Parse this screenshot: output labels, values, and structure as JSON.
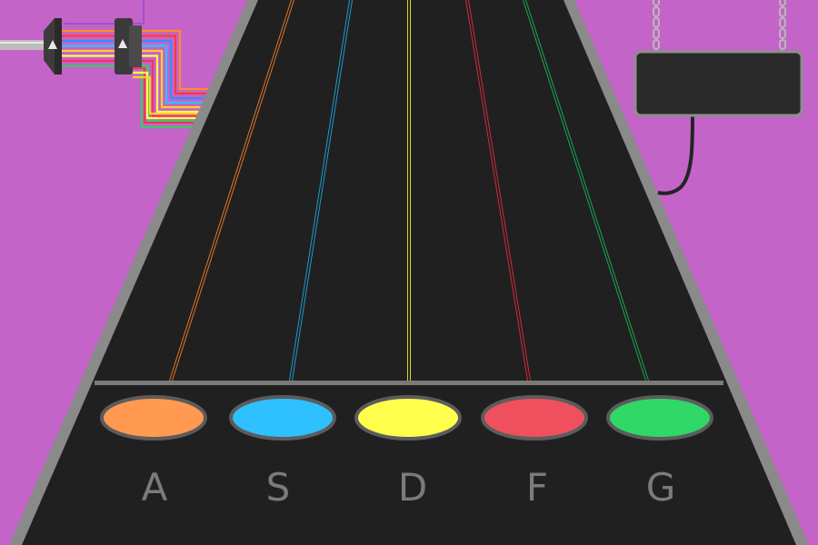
{
  "colors": {
    "background": "#c464c8",
    "highway": "#202020",
    "highway_rail": "#8a8a8a",
    "hit_bar": "#7a7a7a",
    "label": "#7b7b7b",
    "panel": "#2a2a2a",
    "panel_border": "#8e8e8e",
    "chain": "#b8b8b8",
    "cable": "#242424"
  },
  "lanes": [
    {
      "key": "A",
      "color": "#ff9a50",
      "string_color": "#e0752a"
    },
    {
      "key": "S",
      "color": "#2ec0ff",
      "string_color": "#1a9ad0"
    },
    {
      "key": "D",
      "color": "#ffff4c",
      "string_color": "#d8d820"
    },
    {
      "key": "F",
      "color": "#f0505e",
      "string_color": "#d02a36"
    },
    {
      "key": "G",
      "color": "#30d868",
      "string_color": "#1aa84a"
    }
  ],
  "decor": {
    "cable_colors": [
      "#a050d0",
      "#ff8a30",
      "#ff3a3a",
      "#3a8aff",
      "#30c0ff",
      "#ffd020",
      "#ffff50",
      "#ff3060",
      "#30d060"
    ],
    "plug_icon": "triangle-up",
    "panel": "hanging-display"
  }
}
